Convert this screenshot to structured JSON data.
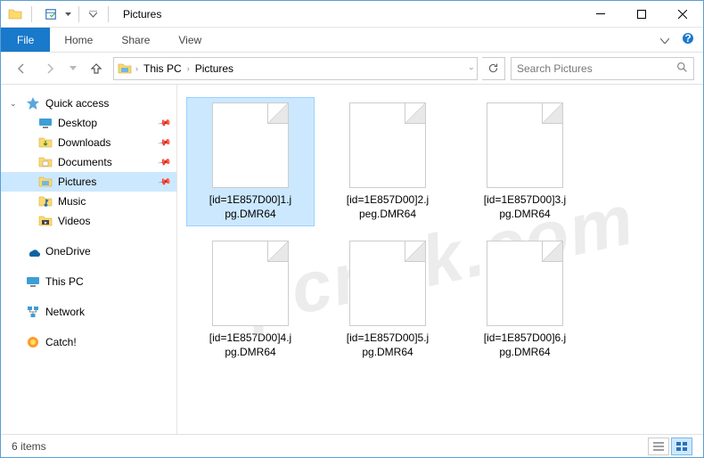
{
  "titlebar": {
    "app_title": "Pictures"
  },
  "ribbon": {
    "file": "File",
    "tabs": [
      "Home",
      "Share",
      "View"
    ]
  },
  "breadcrumb": {
    "items": [
      "This PC",
      "Pictures"
    ]
  },
  "search": {
    "placeholder": "Search Pictures"
  },
  "sidebar": {
    "quick_access": {
      "label": "Quick access",
      "children": [
        {
          "label": "Desktop",
          "icon": "desktop"
        },
        {
          "label": "Downloads",
          "icon": "downloads"
        },
        {
          "label": "Documents",
          "icon": "documents"
        },
        {
          "label": "Pictures",
          "icon": "pictures",
          "selected": true
        },
        {
          "label": "Music",
          "icon": "music"
        },
        {
          "label": "Videos",
          "icon": "videos"
        }
      ]
    },
    "onedrive": {
      "label": "OneDrive"
    },
    "thispc": {
      "label": "This PC"
    },
    "network": {
      "label": "Network"
    },
    "catch": {
      "label": "Catch!"
    }
  },
  "files": [
    {
      "name_line1": "[id=1E857D00]1.j",
      "name_line2": "pg.DMR64",
      "selected": true
    },
    {
      "name_line1": "[id=1E857D00]2.j",
      "name_line2": "peg.DMR64"
    },
    {
      "name_line1": "[id=1E857D00]3.j",
      "name_line2": "pg.DMR64"
    },
    {
      "name_line1": "[id=1E857D00]4.j",
      "name_line2": "pg.DMR64"
    },
    {
      "name_line1": "[id=1E857D00]5.j",
      "name_line2": "pg.DMR64"
    },
    {
      "name_line1": "[id=1E857D00]6.j",
      "name_line2": "pg.DMR64"
    }
  ],
  "statusbar": {
    "count_text": "6 items"
  },
  "watermark": "pcrisk.com"
}
